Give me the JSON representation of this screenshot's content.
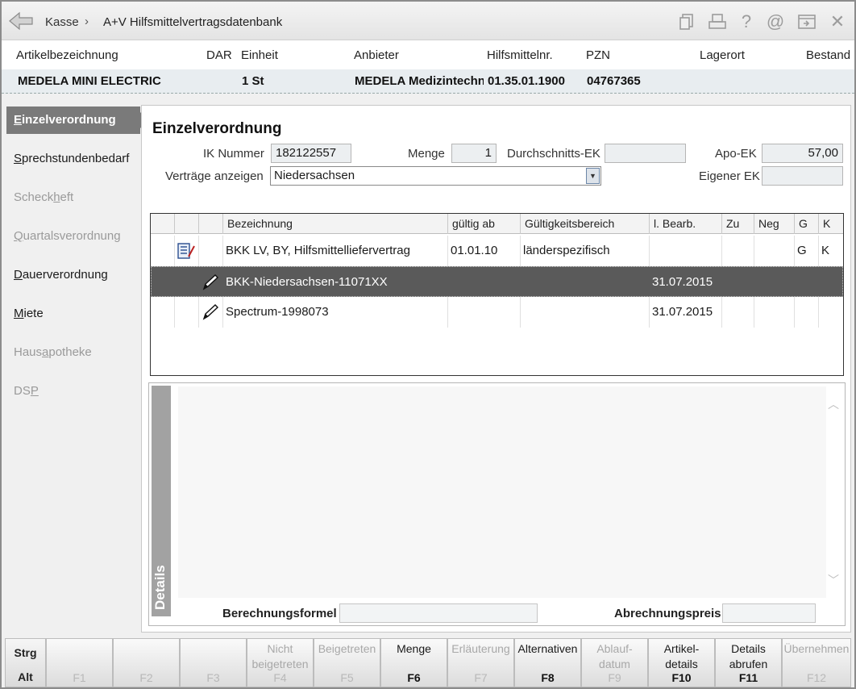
{
  "titlebar": {
    "crumb_home": "Kasse",
    "crumb_sep": "›",
    "crumb_current": "A+V Hilfsmittelvertragsdatenbank",
    "icons": [
      "document-copy-icon",
      "print-icon",
      "help-icon",
      "at-sign-icon",
      "export-window-icon",
      "close-icon"
    ]
  },
  "article": {
    "headers": {
      "artikelbezeichnung": "Artikelbezeichnung",
      "dar": "DAR",
      "einheit": "Einheit",
      "anbieter": "Anbieter",
      "hilfsmittelnr": "Hilfsmittelnr.",
      "pzn": "PZN",
      "lagerort": "Lagerort",
      "bestand": "Bestand"
    },
    "values": {
      "artikelbezeichnung": "MEDELA MINI ELECTRIC",
      "einheit": "1 St",
      "anbieter": "MEDELA Medizintechn",
      "hilfsmittelnr": "01.35.01.1900",
      "pzn": "04767365"
    }
  },
  "sidebar": {
    "items": [
      {
        "pre": "",
        "key": "E",
        "post": "inzelverordnung"
      },
      {
        "pre": "",
        "key": "S",
        "post": "prechstundenbedarf"
      },
      {
        "pre": "Scheck",
        "key": "h",
        "post": "eft"
      },
      {
        "pre": "",
        "key": "Q",
        "post": "uartalsverordnung"
      },
      {
        "pre": "",
        "key": "D",
        "post": "auerverordnung"
      },
      {
        "pre": "",
        "key": "M",
        "post": "iete"
      },
      {
        "pre": "Haus",
        "key": "a",
        "post": "potheke"
      },
      {
        "pre": "DS",
        "key": "P",
        "post": ""
      }
    ]
  },
  "main": {
    "title": "Einzelverordnung",
    "ik_label": "IK Nummer",
    "ik_value": "182122557",
    "menge_label": "Menge",
    "menge_value": "1",
    "dek_label": "Durchschnitts-EK",
    "dek_value": "",
    "apo_label": "Apo-EK",
    "apo_value": "57,00",
    "vertraege_label": "Verträge anzeigen",
    "vertraege_value": "Niedersachsen",
    "eigener_label": "Eigener EK",
    "eigener_value": ""
  },
  "table": {
    "columns": [
      "",
      "",
      "",
      "Bezeichnung",
      "gültig ab",
      "Gültigkeitsbereich",
      "l. Bearb.",
      "Zu",
      "Neg",
      "G",
      "K"
    ],
    "rows": [
      {
        "icon": "contract-document-icon",
        "bezeichnung": "BKK LV, BY, Hilfsmittelliefervertrag",
        "gueltig_ab": "01.01.10",
        "bereich": "länderspezifisch",
        "bearb": "",
        "zu": "",
        "neg": "",
        "g": "G",
        "k": "K"
      },
      {
        "icon": "pencil-icon",
        "bezeichnung": "BKK-Niedersachsen-11071XX",
        "gueltig_ab": "",
        "bereich": "",
        "bearb": "31.07.2015",
        "zu": "",
        "neg": "",
        "g": "",
        "k": ""
      },
      {
        "icon": "pencil-icon",
        "bezeichnung": "Spectrum-1998073",
        "gueltig_ab": "",
        "bereich": "",
        "bearb": "31.07.2015",
        "zu": "",
        "neg": "",
        "g": "",
        "k": ""
      }
    ]
  },
  "details": {
    "tab_label": "Details",
    "formel_label": "Berechnungsformel",
    "preis_label": "Abrechnungspreis"
  },
  "fkeys": {
    "mod1": "Strg",
    "mod2": "Alt",
    "keys": [
      {
        "label": "",
        "key": "F1"
      },
      {
        "label": "",
        "key": "F2"
      },
      {
        "label": "",
        "key": "F3"
      },
      {
        "label": "Nicht beigetreten",
        "key": "F4"
      },
      {
        "label": "Beigetreten",
        "key": "F5"
      },
      {
        "label": "Menge",
        "key": "F6"
      },
      {
        "label": "Erläuterung",
        "key": "F7"
      },
      {
        "label": "Alternativen",
        "key": "F8"
      },
      {
        "label": "Ablauf-datum",
        "key": "F9"
      },
      {
        "label": "Artikel-details",
        "key": "F10"
      },
      {
        "label": "Details abrufen",
        "key": "F11"
      },
      {
        "label": "Übernehmen",
        "key": "F12"
      }
    ]
  },
  "colors": {
    "sidebar_active": "#7a7a7a",
    "selected_row": "#5a5a5a",
    "details_tab": "#a2a2a2"
  }
}
